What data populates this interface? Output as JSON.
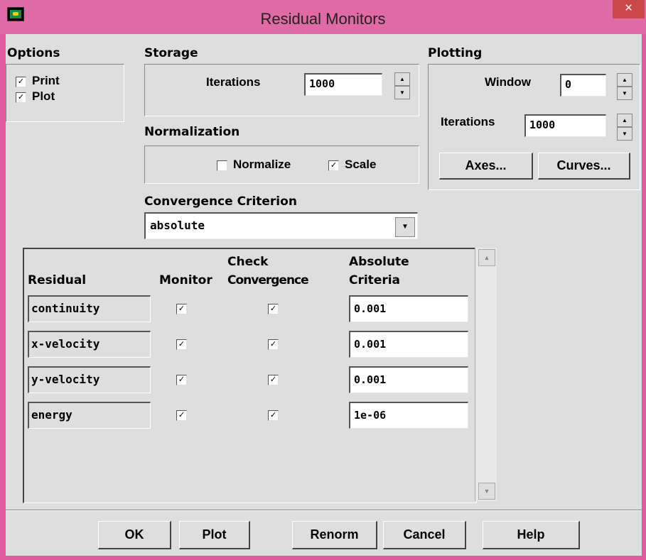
{
  "window": {
    "title": "Residual Monitors",
    "close_glyph": "×"
  },
  "options": {
    "group_label": "Options",
    "print": {
      "label": "Print",
      "checked": true
    },
    "plot": {
      "label": "Plot",
      "checked": true
    }
  },
  "storage": {
    "group_label": "Storage",
    "iterations_label": "Iterations",
    "iterations_value": "1000"
  },
  "normalization": {
    "group_label": "Normalization",
    "normalize": {
      "label": "Normalize",
      "checked": false
    },
    "scale": {
      "label": "Scale",
      "checked": true
    }
  },
  "convergence": {
    "group_label": "Convergence Criterion",
    "selected": "absolute"
  },
  "plotting": {
    "group_label": "Plotting",
    "window_label": "Window",
    "window_value": "0",
    "iterations_label": "Iterations",
    "iterations_value": "1000",
    "axes_button": "Axes...",
    "curves_button": "Curves..."
  },
  "table": {
    "headers": {
      "residual": "Residual",
      "monitor": "Monitor",
      "check_top": "Check",
      "check_bottom": "Convergence",
      "abs_top": "Absolute",
      "abs_bottom": "Criteria"
    },
    "rows": [
      {
        "name": "continuity",
        "monitor": true,
        "check": true,
        "criteria": "0.001"
      },
      {
        "name": "x-velocity",
        "monitor": true,
        "check": true,
        "criteria": "0.001"
      },
      {
        "name": "y-velocity",
        "monitor": true,
        "check": true,
        "criteria": "0.001"
      },
      {
        "name": "energy",
        "monitor": true,
        "check": true,
        "criteria": "1e-06"
      }
    ]
  },
  "buttons": {
    "ok": "OK",
    "plot": "Plot",
    "renorm": "Renorm",
    "cancel": "Cancel",
    "help": "Help"
  },
  "colors": {
    "titlebar": "#e06aa5",
    "dialog_bg": "#dedede",
    "close": "#c9494b"
  }
}
